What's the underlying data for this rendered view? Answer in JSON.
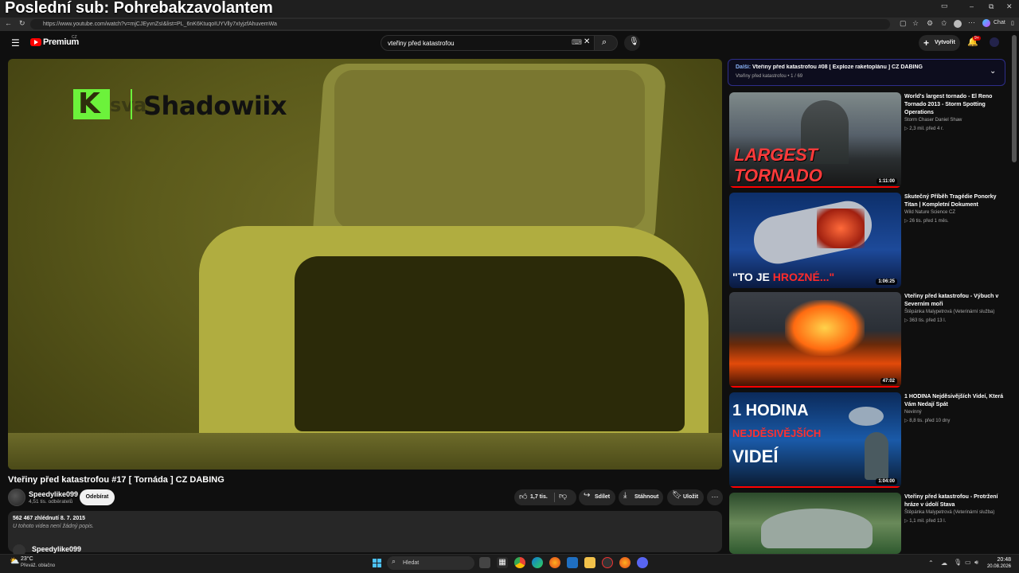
{
  "overlay": {
    "title": "Poslední sub: Pohrebakzavolantem"
  },
  "browser": {
    "url": "https://www.youtube.com/watch?v=mjCJEyvnZsI&list=PL_6nK6KtuqoIUYVlly7xIyjzfAhuvemWa",
    "chat_label": "Chat"
  },
  "header": {
    "logo_text": "Premium",
    "logo_region": "CZ",
    "search_value": "vteřiny před katastrofou",
    "create_label": "Vytvořit",
    "notif_count": "9+"
  },
  "player": {
    "watermark_sva": "sva",
    "watermark_text": "Shadowiix"
  },
  "video": {
    "title": "Vteřiny před katastrofou #17 [ Tornáda ] CZ DABING",
    "channel": "Speedylike099",
    "subscribers": "4,51 tis. odběratelů",
    "subscribe_label": "Odebírat",
    "likes": "1,7 tis.",
    "share_label": "Sdílet",
    "download_label": "Stáhnout",
    "save_label": "Uložit",
    "views_date": "562 467 zhlédnutí  8. 7. 2015",
    "no_description": "U tohoto videa není žádný popis.",
    "comment_author": "Speedylike099"
  },
  "playlist": {
    "next_label": "Další:",
    "next_title": "Vteřiny před katastrofou #08 [ Exploze raketoplánu ] CZ DABING",
    "sub": "Vteřiny před katastrofou • 1 / 69"
  },
  "recommended": [
    {
      "title": "World's largest tornado - El Reno Tornado 2013 - Storm Spotting Operations",
      "channel": "Storm Chaser Daniel Shaw",
      "meta": "▷ 2,3 mil.   před 4 r.",
      "duration": "1:11:00",
      "thumb_text_1": "LARGEST",
      "thumb_text_2": "TORNADO"
    },
    {
      "title": "Skutečný Příběh Tragédie Ponorky Titan | Kompletní Dokument",
      "channel": "Wild Nature Science CZ",
      "meta": "▷ 26 tis.   před 1 měs.",
      "duration": "1:06:25",
      "thumb_text_1": "\"TO JE ",
      "thumb_text_2": "HROZNÉ...\""
    },
    {
      "title": "Vteřiny před katastrofou - Výbuch v Severním moři",
      "channel": "Štěpánka Malypetrová (Veterinární služba)",
      "meta": "▷ 363 tis.   před 13 l.",
      "duration": "47:02"
    },
    {
      "title": "1 HODINA Nejděsivějších Videí, Která Vám Nedají Spát",
      "channel": "Nevinný",
      "meta": "▷ 8,8 tis.   před 10 dny",
      "duration": "1:04:00",
      "thumb_text_1": "1 HODINA",
      "thumb_text_2": "NEJDĚSIVĚJŠÍCH",
      "thumb_text_3": "VIDEÍ"
    },
    {
      "title": "Vteřiny před katastrofou - Protržení hráze v údolí Stava",
      "channel": "Štěpánka Malypetrová (Veterinární služba)",
      "meta": "▷ 1,1 mil.   před 13 l."
    }
  ],
  "taskbar": {
    "temp": "23°C",
    "weather": "Převáž. oblačno",
    "search_placeholder": "Hledat",
    "time": "20:48",
    "date": "20.08.2026"
  },
  "colors": {
    "accent": "#ff0000",
    "bg": "#0f0f0f",
    "watermark_green": "#6cf23b",
    "playlist_border": "#2e2e8a"
  }
}
